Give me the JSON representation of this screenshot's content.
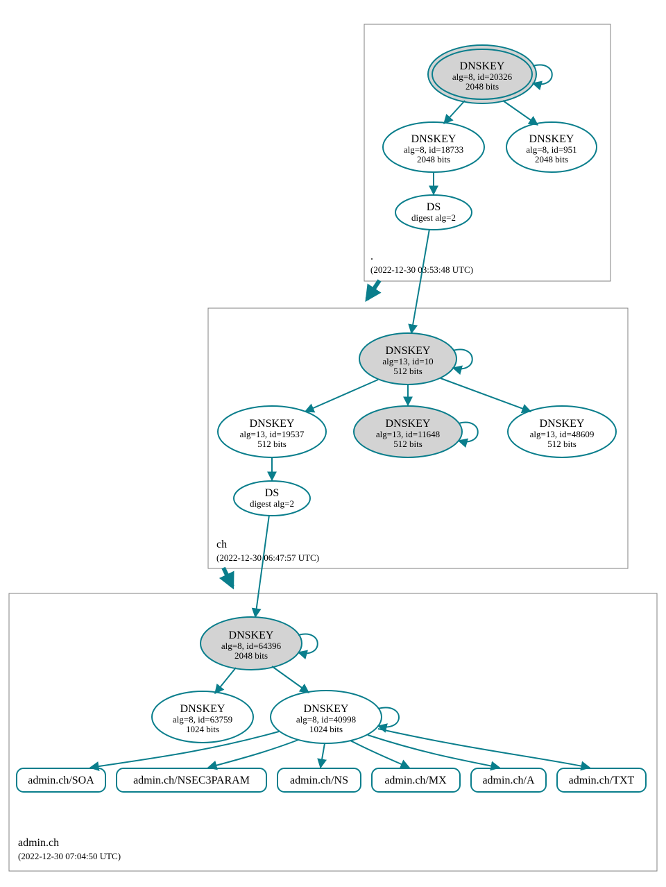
{
  "colors": {
    "accent": "#0a7e8c",
    "nodeFill": "#d3d3d3",
    "boxStroke": "#808080"
  },
  "zones": {
    "root": {
      "name": ".",
      "time": "(2022-12-30 03:53:48 UTC)"
    },
    "ch": {
      "name": "ch",
      "time": "(2022-12-30 06:47:57 UTC)"
    },
    "admin": {
      "name": "admin.ch",
      "time": "(2022-12-30 07:04:50 UTC)"
    }
  },
  "nodes": {
    "root_ksk": {
      "title": "DNSKEY",
      "l2": "alg=8, id=20326",
      "l3": "2048 bits"
    },
    "root_zsk1": {
      "title": "DNSKEY",
      "l2": "alg=8, id=18733",
      "l3": "2048 bits"
    },
    "root_zsk2": {
      "title": "DNSKEY",
      "l2": "alg=8, id=951",
      "l3": "2048 bits"
    },
    "root_ds": {
      "title": "DS",
      "l2": "digest alg=2"
    },
    "ch_ksk": {
      "title": "DNSKEY",
      "l2": "alg=13, id=10",
      "l3": "512 bits"
    },
    "ch_k1": {
      "title": "DNSKEY",
      "l2": "alg=13, id=19537",
      "l3": "512 bits"
    },
    "ch_k2": {
      "title": "DNSKEY",
      "l2": "alg=13, id=11648",
      "l3": "512 bits"
    },
    "ch_k3": {
      "title": "DNSKEY",
      "l2": "alg=13, id=48609",
      "l3": "512 bits"
    },
    "ch_ds": {
      "title": "DS",
      "l2": "digest alg=2"
    },
    "admin_ksk": {
      "title": "DNSKEY",
      "l2": "alg=8, id=64396",
      "l3": "2048 bits"
    },
    "admin_k1": {
      "title": "DNSKEY",
      "l2": "alg=8, id=63759",
      "l3": "1024 bits"
    },
    "admin_k2": {
      "title": "DNSKEY",
      "l2": "alg=8, id=40998",
      "l3": "1024 bits"
    }
  },
  "rrsets": {
    "soa": "admin.ch/SOA",
    "nsec3p": "admin.ch/NSEC3PARAM",
    "ns": "admin.ch/NS",
    "mx": "admin.ch/MX",
    "a": "admin.ch/A",
    "txt": "admin.ch/TXT"
  }
}
